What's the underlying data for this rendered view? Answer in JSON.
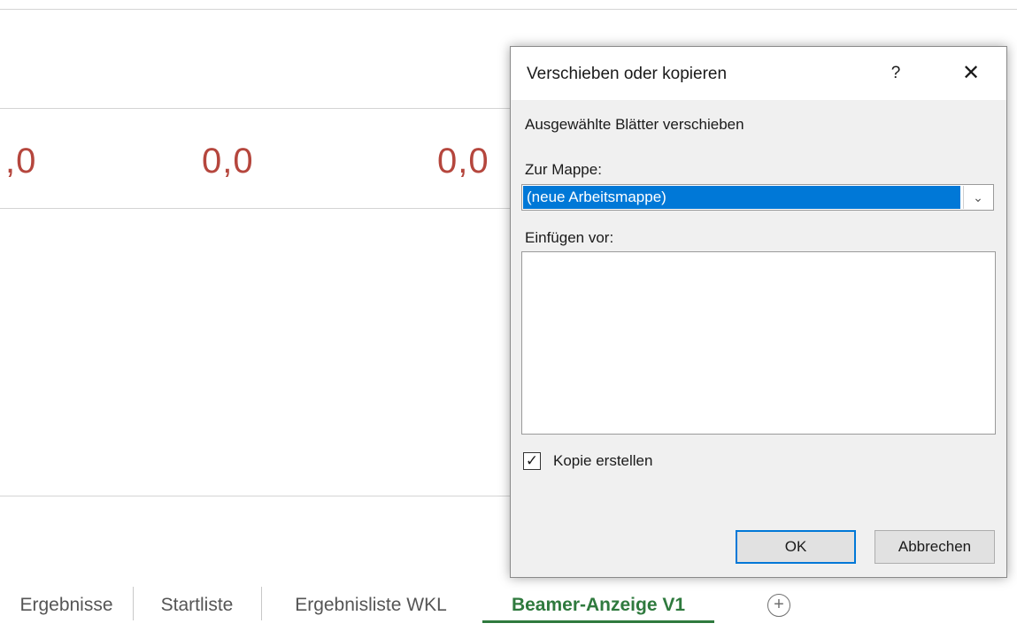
{
  "sheet": {
    "cell_values": [
      ",0",
      "0,0",
      "0,0"
    ],
    "cell_color": "#b5463d"
  },
  "tabs": [
    {
      "label": "Ergebnisse",
      "active": false
    },
    {
      "label": "Startliste",
      "active": false
    },
    {
      "label": "Ergebnisliste WKL",
      "active": false
    },
    {
      "label": "Beamer-Anzeige V1",
      "active": true
    }
  ],
  "add_sheet_symbol": "+",
  "accent_color": "#2f7a3e",
  "dialog": {
    "title": "Verschieben oder kopieren",
    "help_symbol": "?",
    "close_symbol": "✕",
    "subtitle": "Ausgewählte Blätter verschieben",
    "workbook_label": "Zur Mappe:",
    "workbook_selected": "(neue Arbeitsmappe)",
    "insert_before_label": "Einfügen vor:",
    "insert_before_items": [],
    "copy_checkbox_label": "Kopie erstellen",
    "copy_checked": true,
    "ok_label": "OK",
    "cancel_label": "Abbrechen",
    "selection_color": "#0078d7"
  }
}
